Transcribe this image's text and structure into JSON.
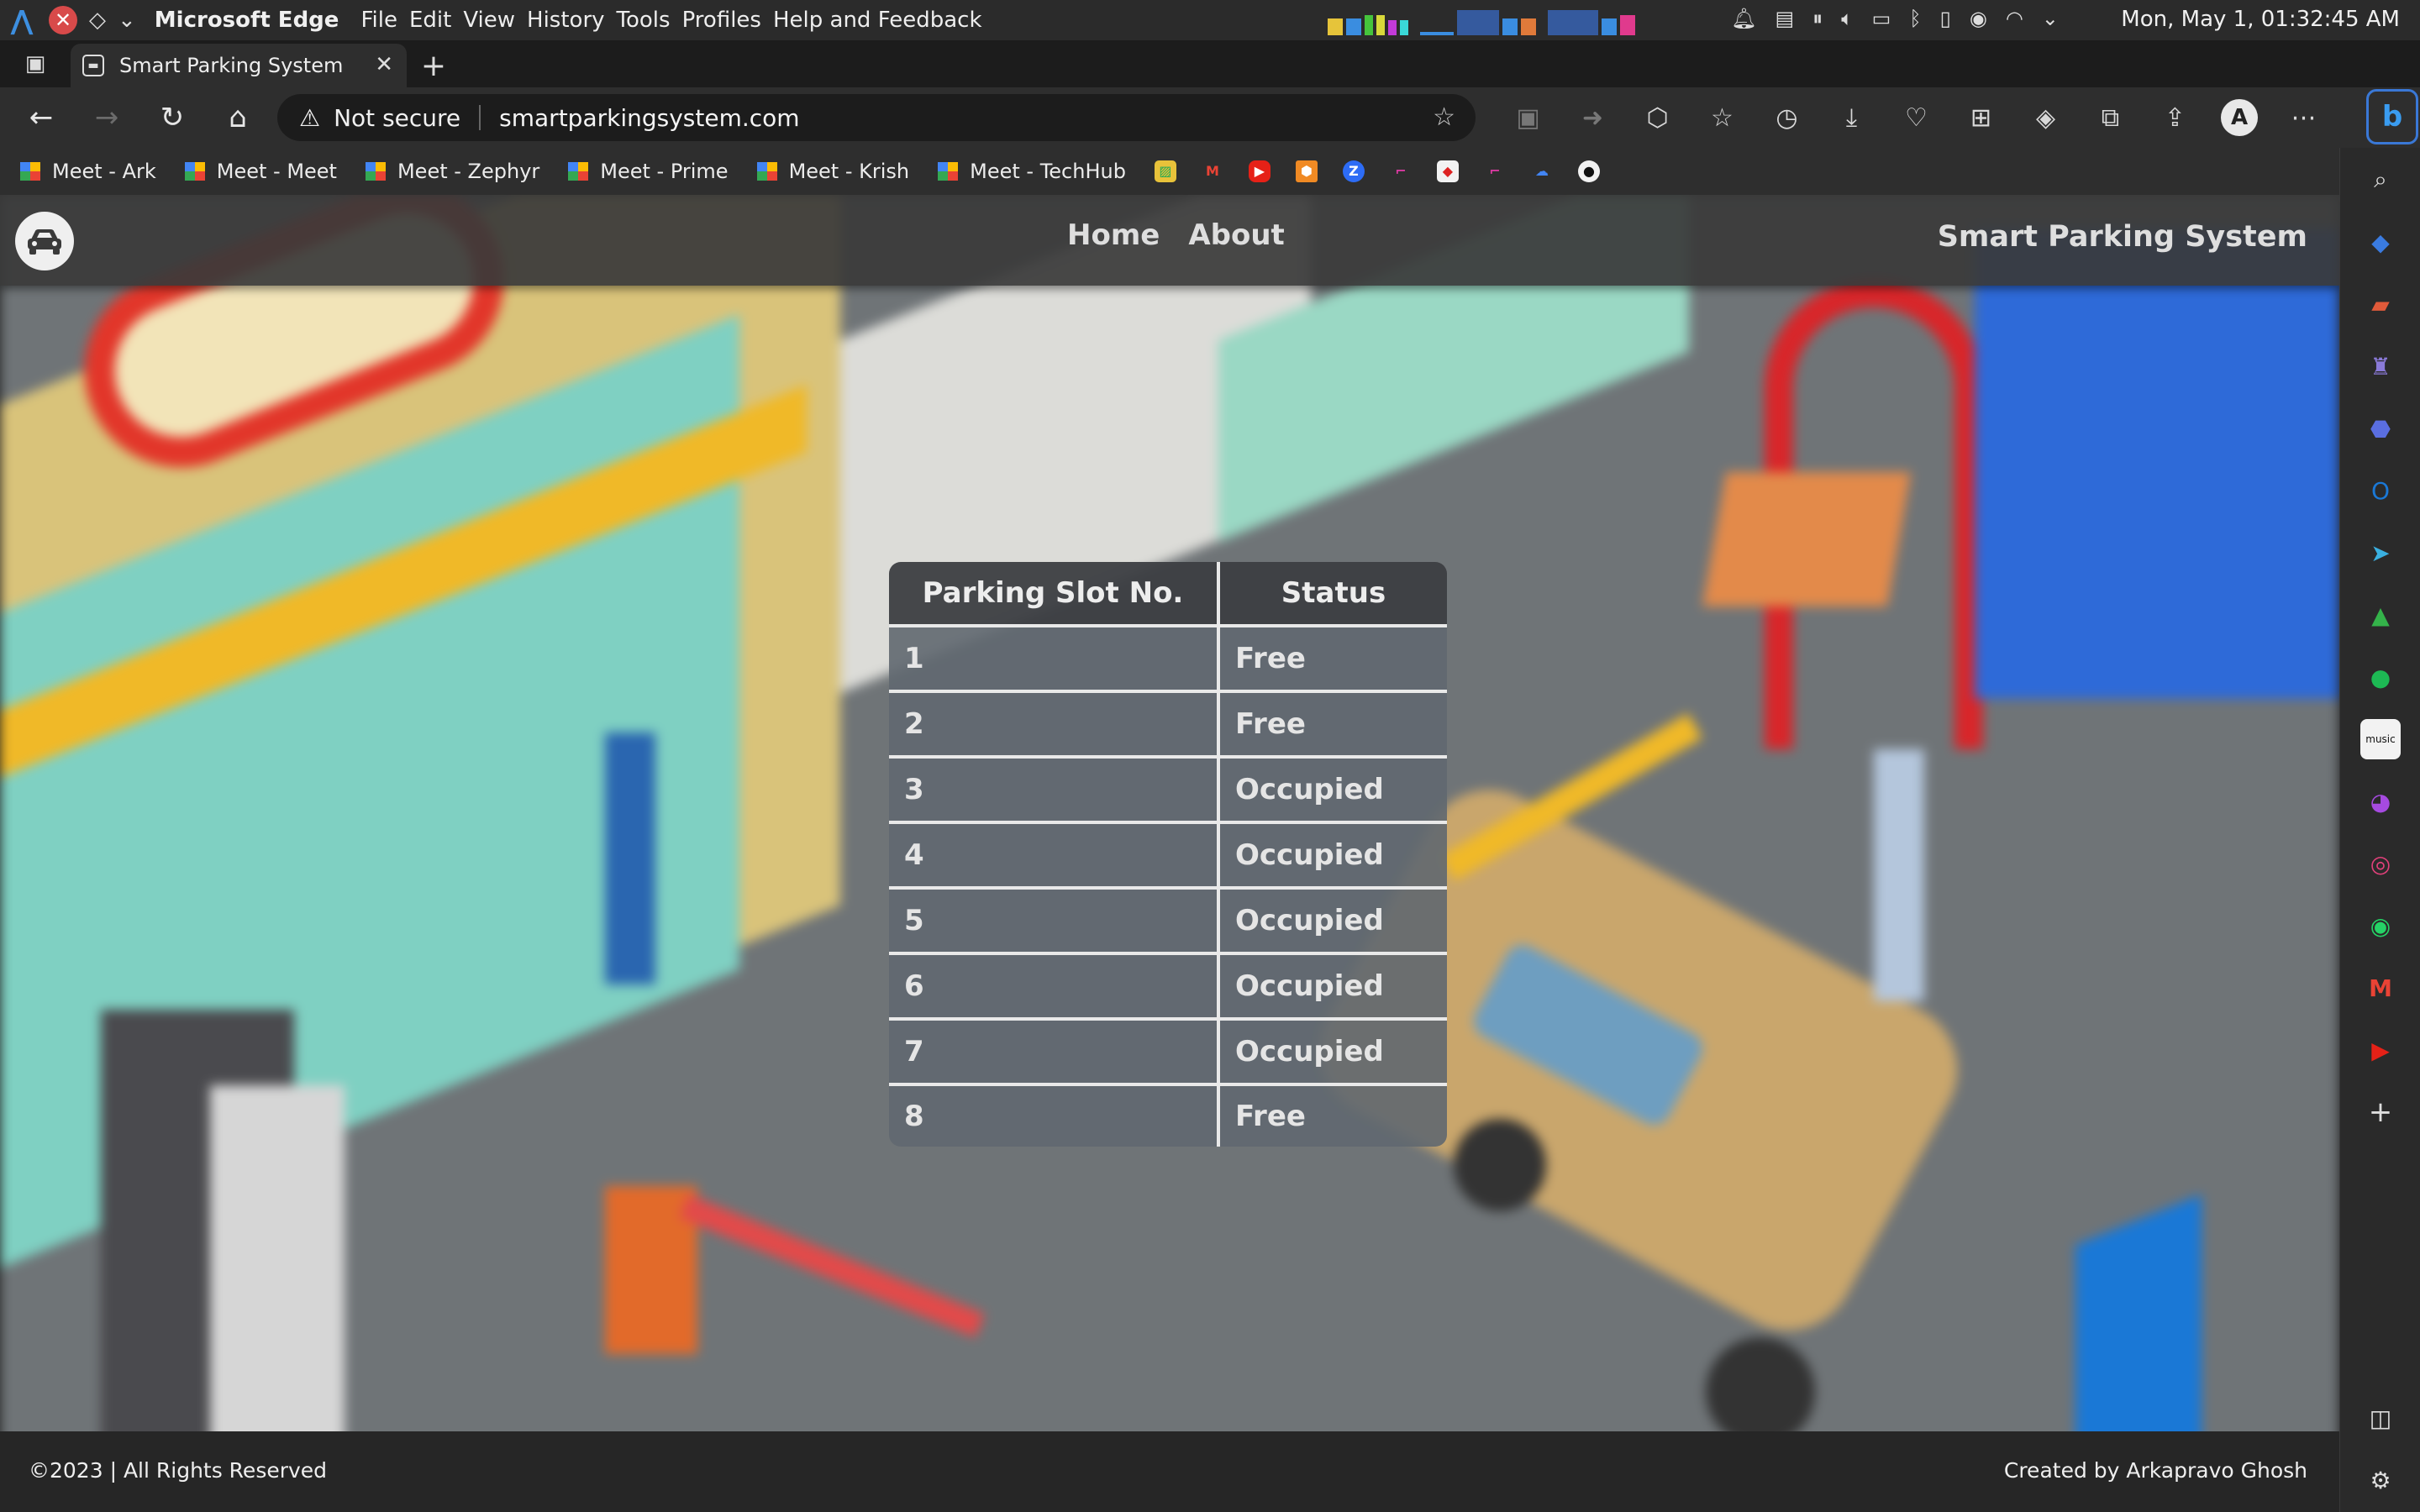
{
  "os": {
    "app_name": "Microsoft Edge",
    "menu": [
      "File",
      "Edit",
      "View",
      "History",
      "Tools",
      "Profiles",
      "Help and Feedback"
    ],
    "clock": "Mon, May 1, 01:32:45 AM"
  },
  "browser": {
    "tab_title": "Smart Parking System",
    "address": {
      "security_label": "Not secure",
      "url": "smartparkingsystem.com"
    },
    "bookmarks": [
      "Meet - Ark",
      "Meet - Meet",
      "Meet - Zephyr",
      "Meet - Prime",
      "Meet - Krish",
      "Meet - TechHub"
    ],
    "bookmark_icons": [
      "photos-icon",
      "gmail-icon",
      "youtube-icon",
      "package-icon",
      "zoom-icon",
      "bracket-icon",
      "record-icon",
      "bracket-icon",
      "google-cloud-icon",
      "github-icon"
    ],
    "profile_initial": "A",
    "sidebar_icons": [
      "search-icon",
      "tag-icon",
      "briefcase-icon",
      "games-icon",
      "copilot-icon",
      "outlook-icon",
      "send-icon",
      "tree-icon",
      "spotify-icon",
      "amazon-music-icon",
      "messenger-icon",
      "instagram-icon",
      "whatsapp-icon",
      "gmail-icon",
      "youtube-icon",
      "add-icon",
      "split-view-icon",
      "settings-icon"
    ]
  },
  "site": {
    "nav": {
      "home": "Home",
      "about": "About"
    },
    "title": "Smart Parking System",
    "table": {
      "headers": [
        "Parking Slot No.",
        "Status"
      ],
      "rows": [
        {
          "slot": "1",
          "status": "Free"
        },
        {
          "slot": "2",
          "status": "Free"
        },
        {
          "slot": "3",
          "status": "Occupied"
        },
        {
          "slot": "4",
          "status": "Occupied"
        },
        {
          "slot": "5",
          "status": "Occupied"
        },
        {
          "slot": "6",
          "status": "Occupied"
        },
        {
          "slot": "7",
          "status": "Occupied"
        },
        {
          "slot": "8",
          "status": "Free"
        }
      ]
    },
    "footer": {
      "copyright": "©2023 | All Rights Reserved",
      "credit": "Created by Arkapravo Ghosh"
    }
  }
}
